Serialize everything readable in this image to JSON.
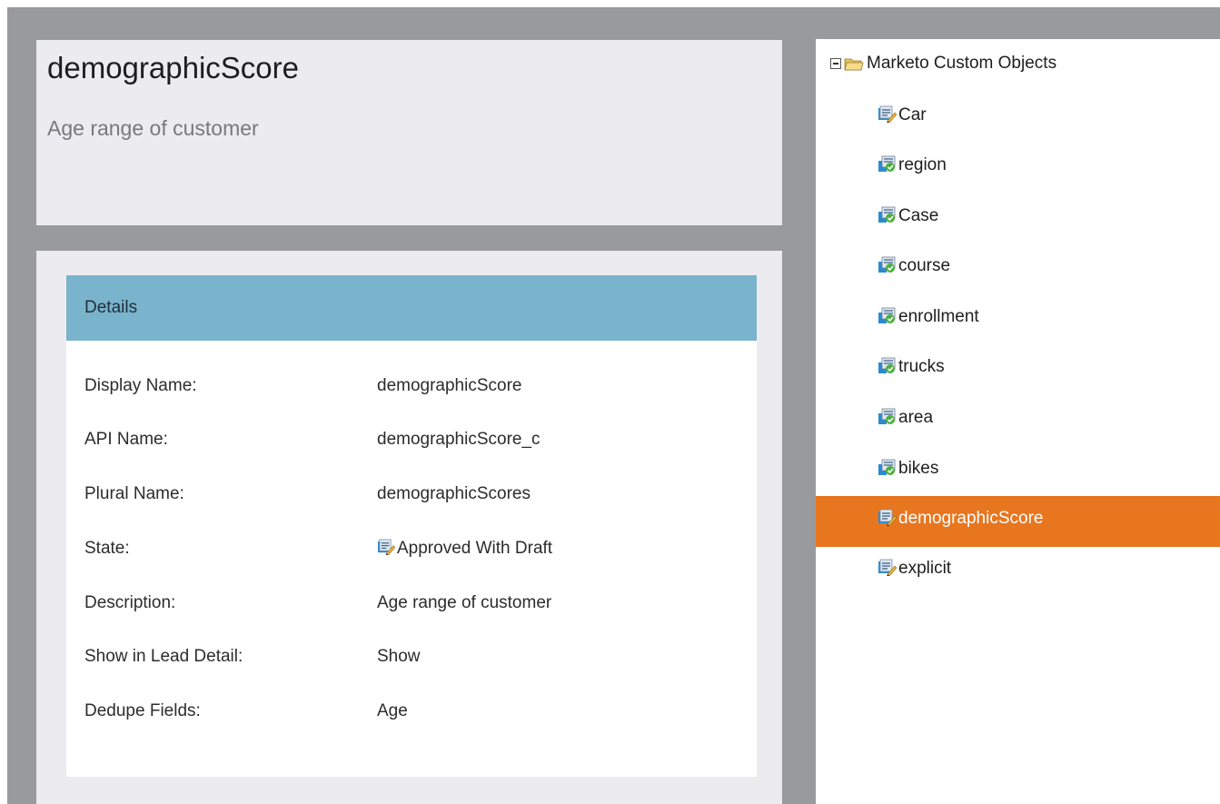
{
  "header": {
    "title": "demographicScore",
    "subtitle": "Age range of customer"
  },
  "details": {
    "section_label": "Details",
    "rows": [
      {
        "label": "Display Name:",
        "value": "demographicScore"
      },
      {
        "label": "API Name:",
        "value": "demographicScore_c"
      },
      {
        "label": "Plural Name:",
        "value": "demographicScores"
      },
      {
        "label": "State:",
        "value": "Approved With Draft",
        "icon": "draft-object-icon"
      },
      {
        "label": "Description:",
        "value": "Age range of customer"
      },
      {
        "label": "Show in Lead Detail:",
        "value": "Show"
      },
      {
        "label": "Dedupe Fields:",
        "value": "Age"
      }
    ]
  },
  "tree": {
    "root": {
      "label": "Marketo Custom Objects",
      "expanded": true,
      "icon": "folder-icon"
    },
    "items": [
      {
        "label": "Car",
        "icon": "draft-object-icon",
        "selected": false
      },
      {
        "label": "region",
        "icon": "approved-object-icon",
        "selected": false
      },
      {
        "label": "Case",
        "icon": "approved-object-icon",
        "selected": false
      },
      {
        "label": "course",
        "icon": "approved-object-icon",
        "selected": false
      },
      {
        "label": "enrollment",
        "icon": "approved-object-icon",
        "selected": false
      },
      {
        "label": "trucks",
        "icon": "approved-object-icon",
        "selected": false
      },
      {
        "label": "area",
        "icon": "approved-object-icon",
        "selected": false
      },
      {
        "label": "bikes",
        "icon": "approved-object-icon",
        "selected": false
      },
      {
        "label": "demographicScore",
        "icon": "draft-object-icon",
        "selected": true
      },
      {
        "label": "explicit",
        "icon": "draft-object-icon",
        "selected": false
      }
    ]
  },
  "colors": {
    "frame": "#999a9d",
    "card": "#ebebf0",
    "details_header": "#7ab3cc",
    "selected": "#e8761f"
  }
}
